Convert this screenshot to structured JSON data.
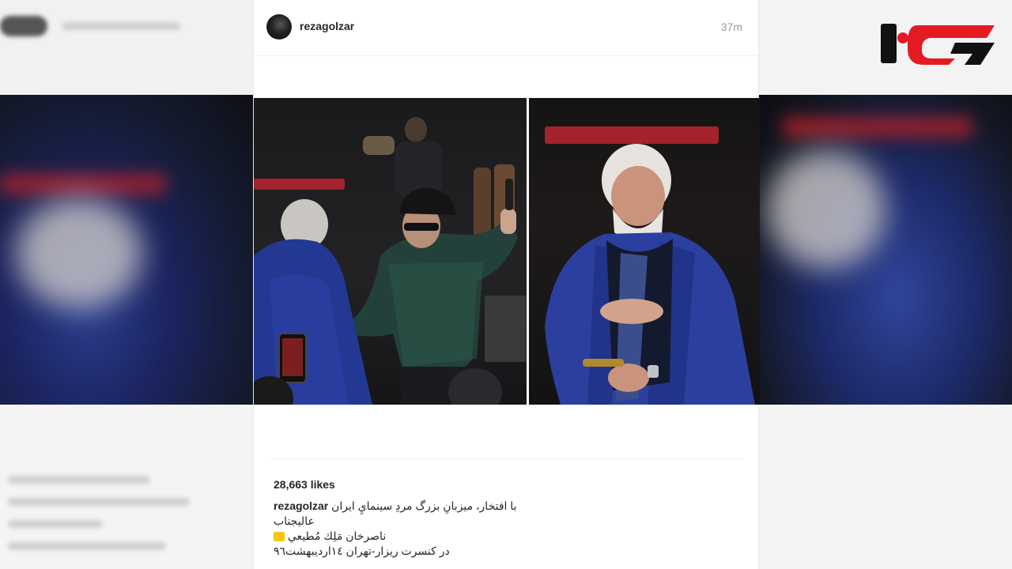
{
  "post": {
    "username": "rezagolzar",
    "time": "37m",
    "likes": "28,663 likes",
    "caption": {
      "username": "rezagolzar",
      "line1": "با افتخار، میزبانِ بزرگ مردِ سینمايِ ایران",
      "line2": "عالیجناب",
      "line3": "ناصرخان مَلِك مُطيعي",
      "line4": "در کنسرت ریزار-تهران ١٤ارديبهشت٩٦"
    }
  },
  "logo": {
    "icon": "red-logo",
    "color": "#e41b23",
    "dark": "#111111"
  },
  "colors": {
    "accent_red": "#b3242e",
    "jacket_blue": "#2b3f9e"
  }
}
